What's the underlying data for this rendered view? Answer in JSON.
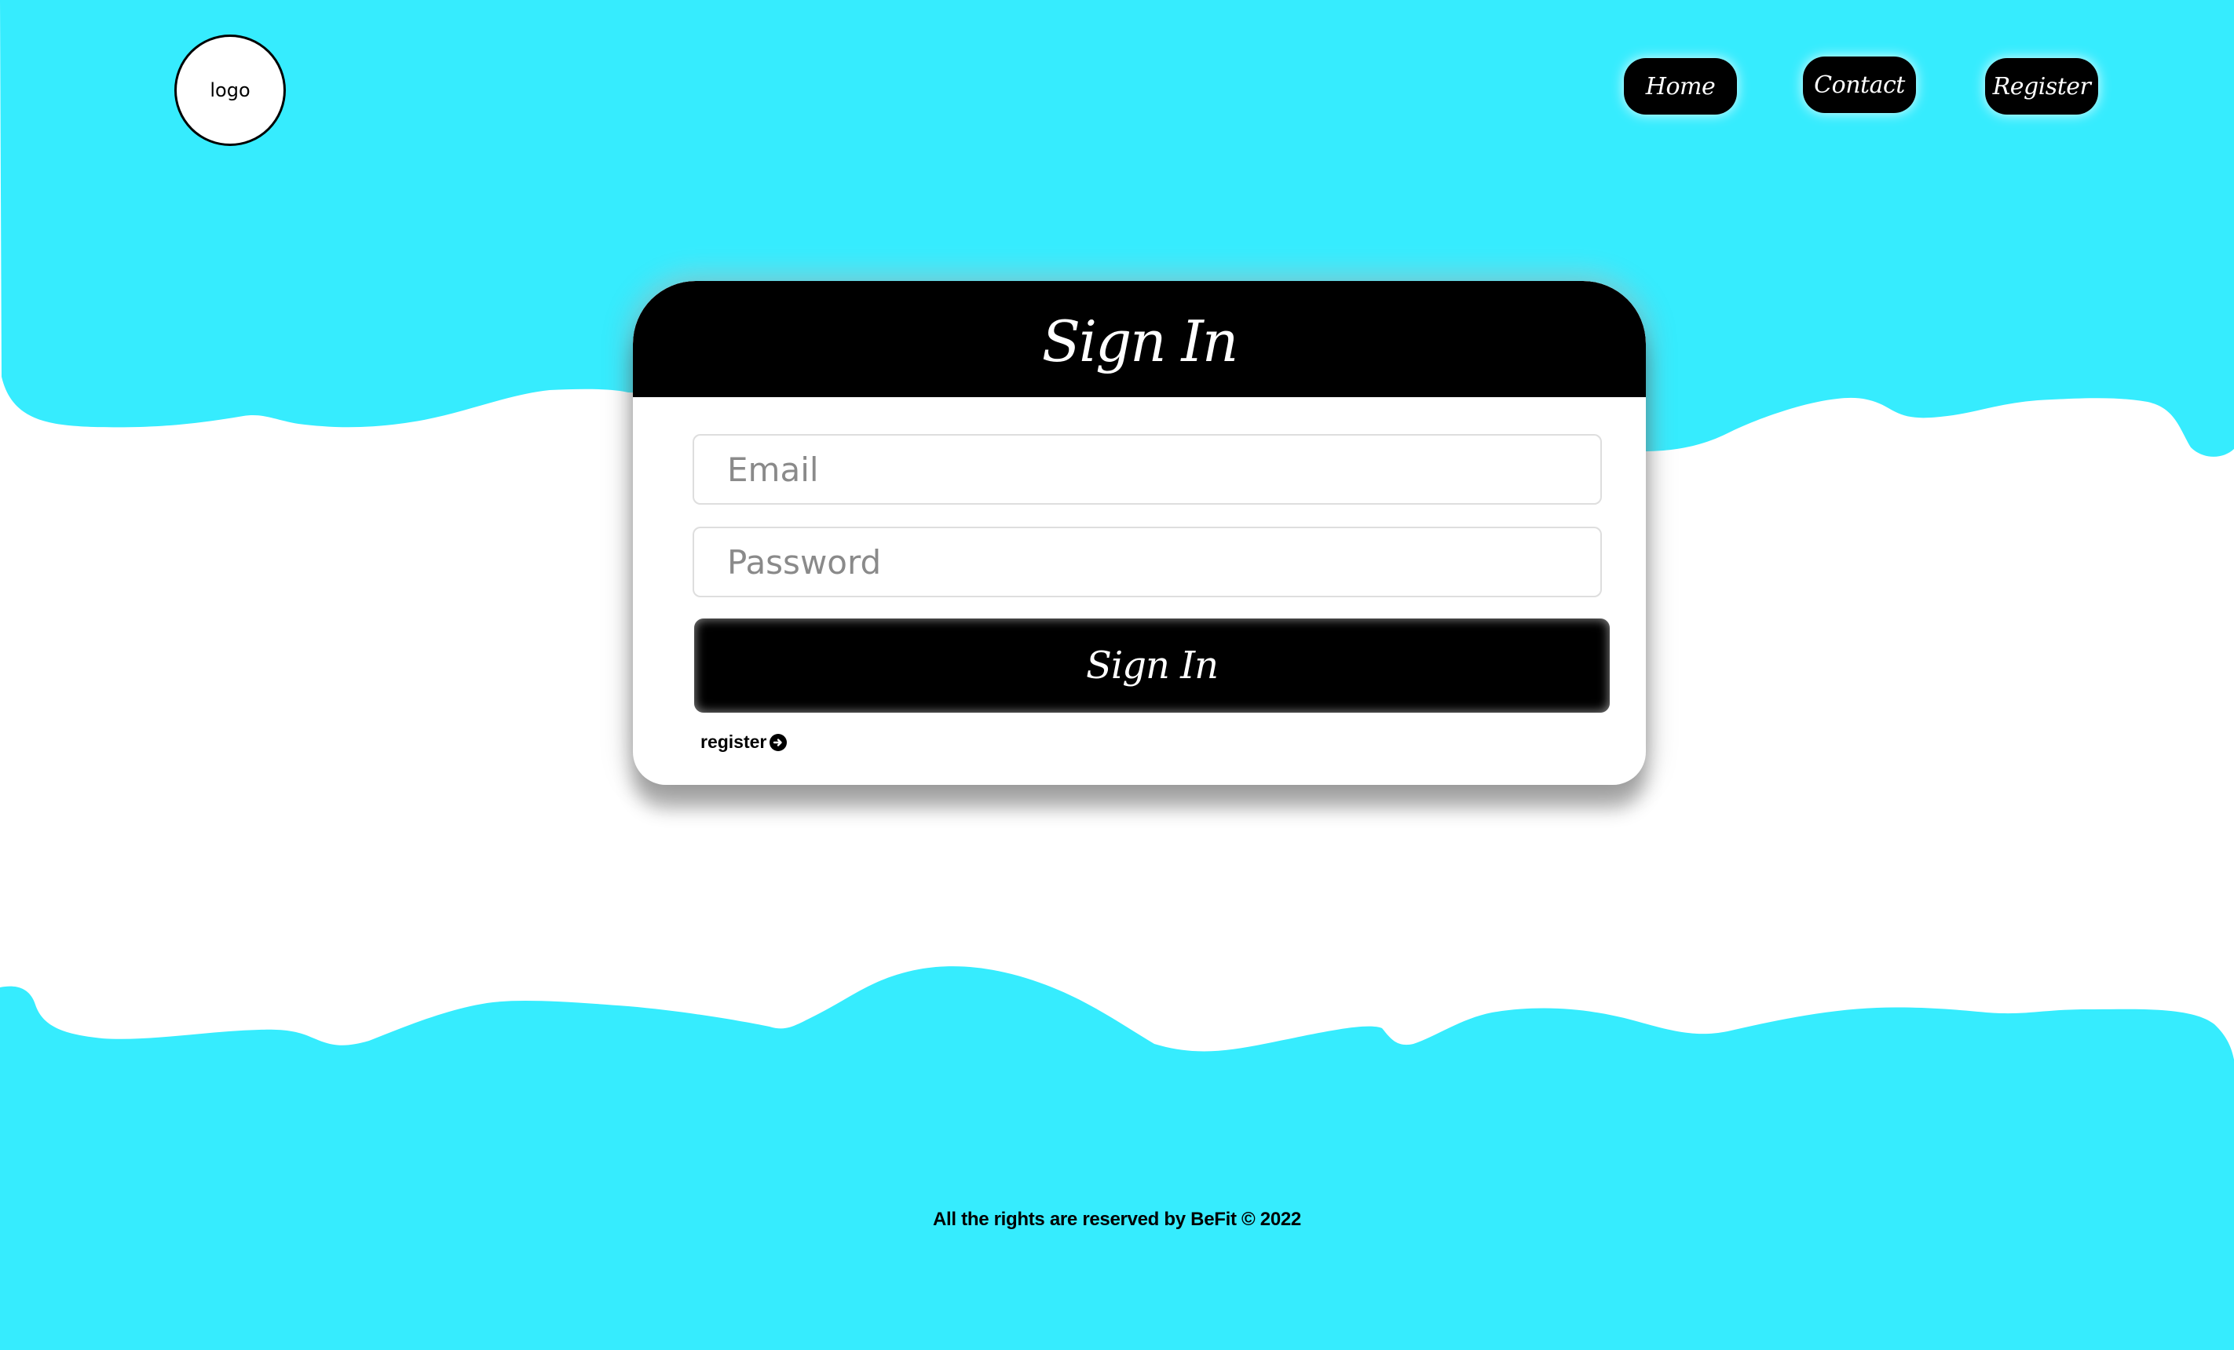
{
  "colors": {
    "brand_cyan": "#36ECFE",
    "black": "#000000",
    "white": "#FFFFFF"
  },
  "header": {
    "logo_text": "logo",
    "nav": [
      {
        "label": "Home"
      },
      {
        "label": "Contact"
      },
      {
        "label": "Register"
      }
    ]
  },
  "signin_card": {
    "title": "Sign In",
    "email_placeholder": "Email",
    "password_placeholder": "Password",
    "submit_label": "Sign In",
    "register_link_label": "register",
    "register_icon": "arrow-right-circle-icon"
  },
  "footer": {
    "text": "All the rights are reserved by BeFit © 2022"
  }
}
